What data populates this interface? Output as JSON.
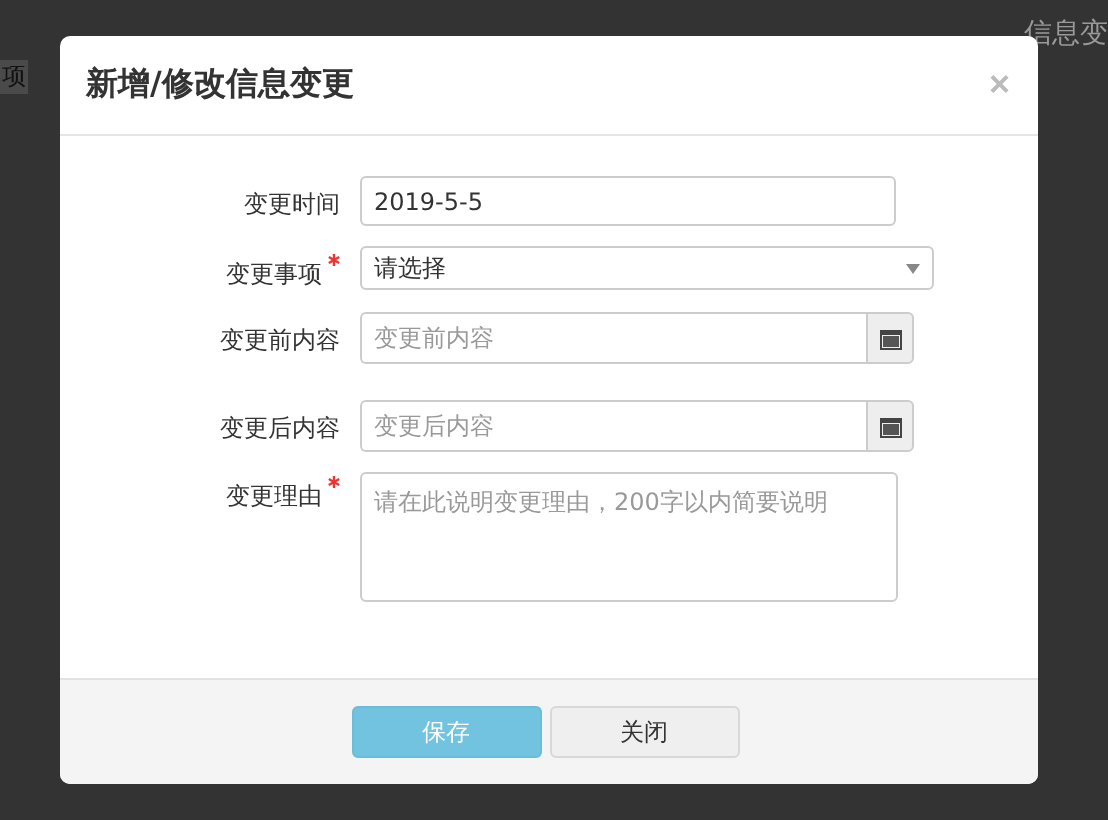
{
  "background": {
    "left_text": "项",
    "right_text": "信息变"
  },
  "dialog": {
    "title": "新增/修改信息变更",
    "close": "×",
    "fields": [
      {
        "kind": "text",
        "label": "变更时间",
        "required": false,
        "value": "2019-5-5"
      },
      {
        "kind": "select",
        "label": "变更事项",
        "required": true,
        "value": "请选择"
      },
      {
        "kind": "addon",
        "label": "变更前内容",
        "required": false,
        "placeholder": "变更前内容"
      },
      {
        "kind": "addon",
        "label": "变更后内容",
        "required": false,
        "placeholder": "变更后内容"
      },
      {
        "kind": "textarea",
        "label": "变更理由",
        "required": true,
        "placeholder": "请在此说明变更理由，200字以内简要说明"
      }
    ],
    "buttons": [
      {
        "label": "保存",
        "kind": "primary"
      },
      {
        "label": "关闭",
        "kind": "default"
      }
    ]
  }
}
